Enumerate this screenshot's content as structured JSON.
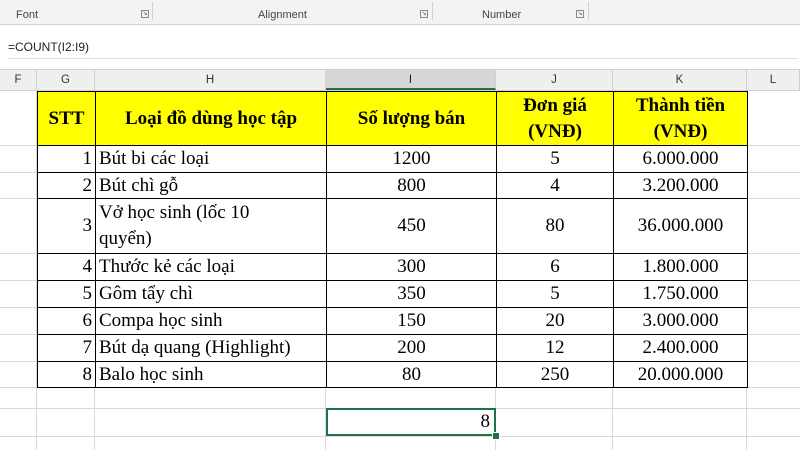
{
  "ribbon": {
    "groups": [
      {
        "label": "Font"
      },
      {
        "label": "Alignment"
      },
      {
        "label": "Number"
      }
    ],
    "launcher_glyph": "↘"
  },
  "formula_bar": {
    "value": "=COUNT(I2:I9)"
  },
  "columns": [
    "F",
    "G",
    "H",
    "I",
    "J",
    "K",
    "L"
  ],
  "selected_column": "I",
  "table": {
    "headers": {
      "stt": "STT",
      "item": "Loại đồ dùng học tập",
      "qty": "Số lượng bán",
      "price_line1": "Đơn giá",
      "price_line2": "(VNĐ)",
      "total_line1": "Thành tiền",
      "total_line2": "(VNĐ)"
    },
    "rows": [
      {
        "stt": "1",
        "item": "Bút bi các loại",
        "qty": "1200",
        "price": "5",
        "total": "6.000.000"
      },
      {
        "stt": "2",
        "item": "Bút chì gỗ",
        "qty": "800",
        "price": "4",
        "total": "3.200.000"
      },
      {
        "stt": "3",
        "item_line1": "Vở học sinh (lốc 10",
        "item_line2": "quyển)",
        "qty": "450",
        "price": "80",
        "total": "36.000.000"
      },
      {
        "stt": "4",
        "item": "Thước kẻ các loại",
        "qty": "300",
        "price": "6",
        "total": "1.800.000"
      },
      {
        "stt": "5",
        "item": "Gôm tẩy chì",
        "qty": "350",
        "price": "5",
        "total": "1.750.000"
      },
      {
        "stt": "6",
        "item": "Compa học sinh",
        "qty": "150",
        "price": "20",
        "total": "3.000.000"
      },
      {
        "stt": "7",
        "item": "Bút dạ quang (Highlight)",
        "qty": "200",
        "price": "12",
        "total": "2.400.000"
      },
      {
        "stt": "8",
        "item": "Balo học sinh",
        "qty": "80",
        "price": "250",
        "total": "20.000.000"
      }
    ]
  },
  "active_cell": {
    "value": "8"
  },
  "colors": {
    "accent": "#217346",
    "header_fill": "#ffff00"
  }
}
